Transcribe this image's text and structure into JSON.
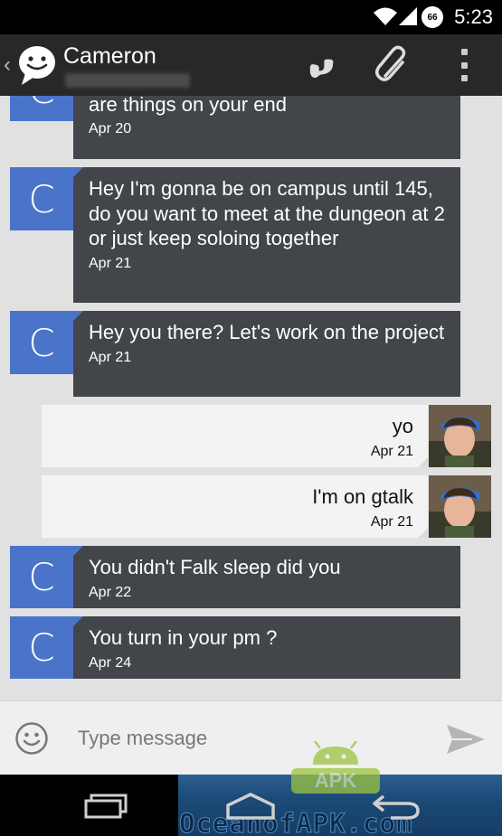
{
  "status_bar": {
    "time": "5:23",
    "battery_level": "66"
  },
  "action_bar": {
    "contact_name": "Cameron"
  },
  "conversation": {
    "messages": [
      {
        "direction": "incoming",
        "avatar_letter": "C",
        "text": "irrigation surround checking works. How are things on your end",
        "date": "Apr 20"
      },
      {
        "direction": "incoming",
        "avatar_letter": "C",
        "text": "Hey I'm gonna be on campus until 145, do you want to meet at the dungeon at 2 or just keep soloing together",
        "date": "Apr 21"
      },
      {
        "direction": "incoming",
        "avatar_letter": "C",
        "text": "Hey you there? Let's work on the project",
        "date": "Apr 21"
      },
      {
        "direction": "outgoing",
        "text": "yo",
        "date": "Apr 21"
      },
      {
        "direction": "outgoing",
        "text": "I'm on gtalk",
        "date": "Apr 21"
      },
      {
        "direction": "incoming",
        "avatar_letter": "C",
        "text": "You didn't Falk sleep did you",
        "date": "Apr 22"
      },
      {
        "direction": "incoming",
        "avatar_letter": "C",
        "text": "You turn in your pm ?",
        "date": "Apr 24"
      }
    ]
  },
  "compose": {
    "placeholder": "Type message",
    "value": ""
  },
  "watermark": {
    "text": "OceanofAPK.com",
    "badge": "APK"
  },
  "colors": {
    "contact_avatar": "#4a74c9",
    "incoming_bubble": "#42464a",
    "outgoing_bubble": "#f3f3f3",
    "conversation_bg": "#e1e1e1",
    "action_bar": "#282828"
  }
}
